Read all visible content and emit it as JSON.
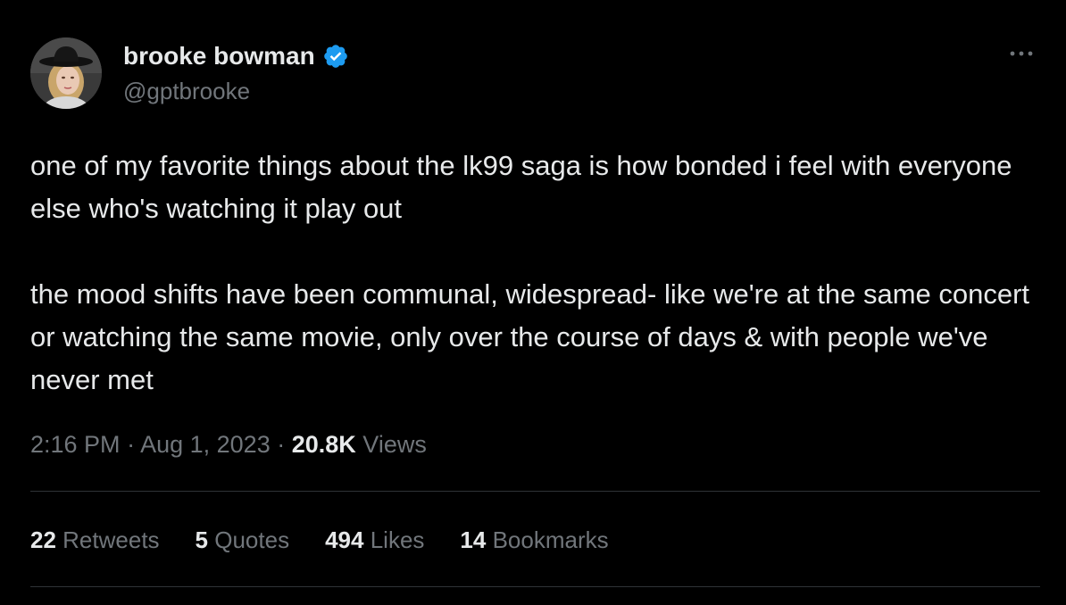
{
  "user": {
    "display_name": "brooke bowman",
    "handle": "@gptbrooke",
    "verified": true,
    "verified_color": "#1d9bf0",
    "avatar_icon": "profile-photo"
  },
  "more_icon": "ellipsis-icon",
  "tweet": {
    "paragraph_1": "one of my favorite things about the lk99 saga is how bonded i feel with everyone else who's watching it play out",
    "paragraph_2": "the mood shifts have been communal, widespread- like we're at the same concert or watching the same movie, only over the course of days & with people we've never met"
  },
  "meta": {
    "time": "2:16 PM",
    "separator": " · ",
    "date": "Aug 1, 2023",
    "views_count": "20.8K",
    "views_label": "Views"
  },
  "stats": {
    "retweets": {
      "count": "22",
      "label": "Retweets"
    },
    "quotes": {
      "count": "5",
      "label": "Quotes"
    },
    "likes": {
      "count": "494",
      "label": "Likes"
    },
    "bookmarks": {
      "count": "14",
      "label": "Bookmarks"
    }
  },
  "colors": {
    "background": "#000000",
    "primary_text": "#e7e9ea",
    "secondary_text": "#71767b",
    "divider": "#2f3336"
  }
}
